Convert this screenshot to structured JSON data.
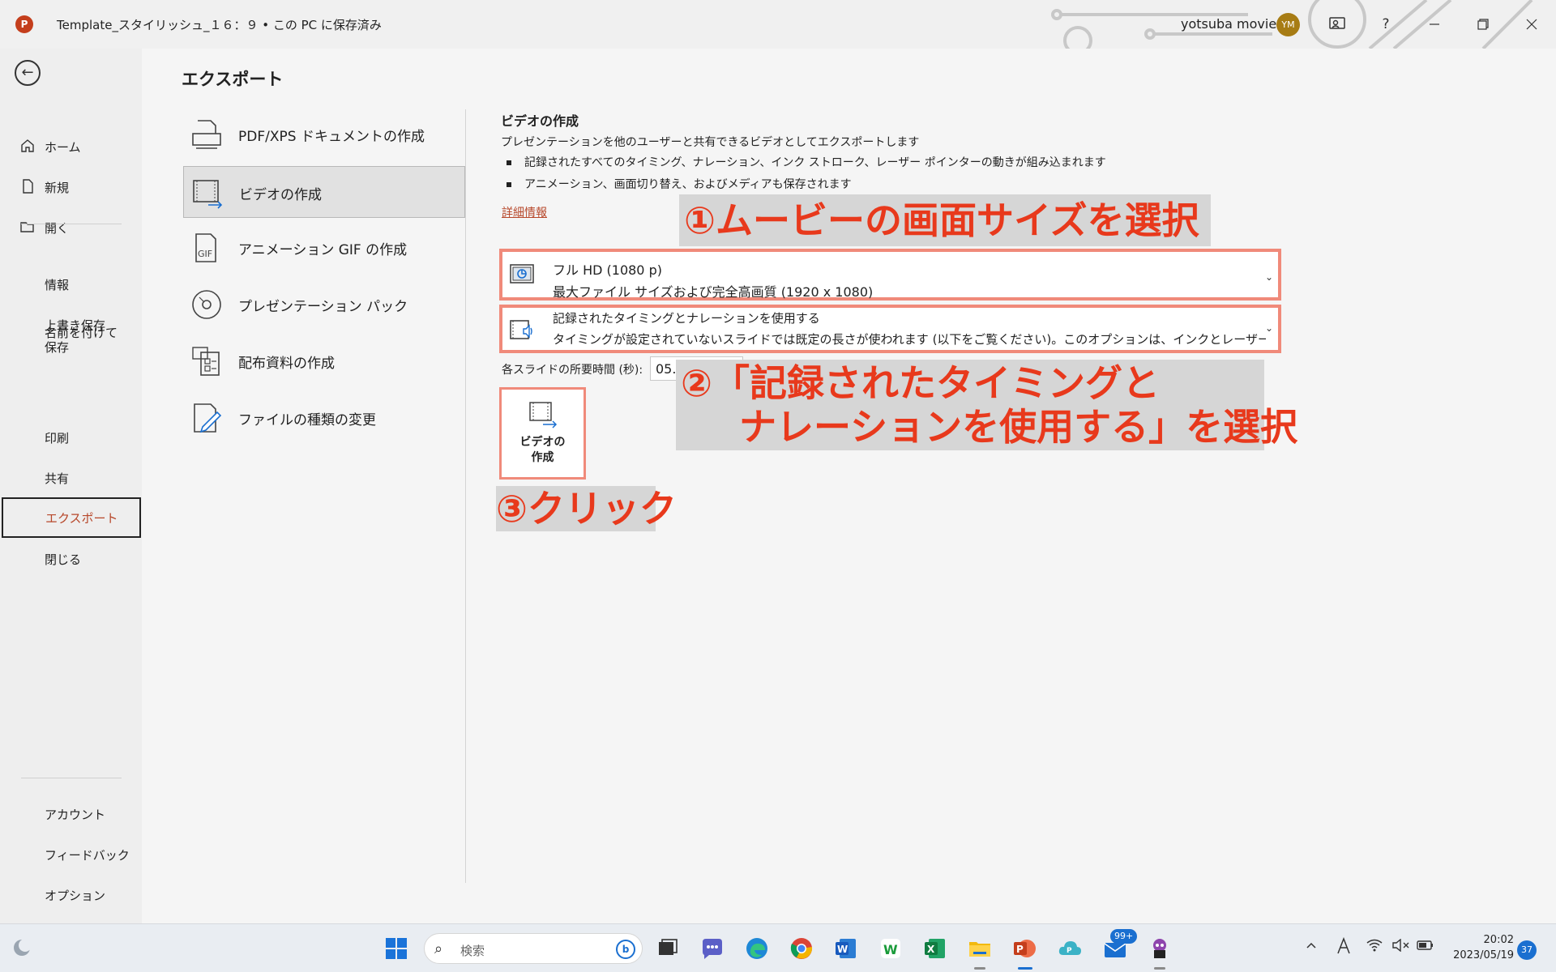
{
  "titlebar": {
    "app_icon": "P",
    "doc_title": "Template_スタイリッシュ_１６：９ • この PC に保存済み",
    "user_name": "yotsuba movie",
    "user_initials": "YM",
    "help": "?",
    "icons": [
      "coauthor-icon",
      "help-icon",
      "minimize-icon",
      "restore-icon",
      "close-icon"
    ]
  },
  "nav": {
    "items": [
      {
        "label": "ホーム",
        "icon": "home-icon"
      },
      {
        "label": "新規",
        "icon": "new-doc-icon"
      },
      {
        "label": "開く",
        "icon": "folder-open-icon"
      },
      {
        "label": "情報"
      },
      {
        "label": "上書き保存"
      },
      {
        "label": "名前を付けて保存"
      },
      {
        "label": "印刷"
      },
      {
        "label": "共有"
      },
      {
        "label": "エクスポート"
      },
      {
        "label": "閉じる"
      }
    ],
    "bottom": [
      {
        "label": "アカウント"
      },
      {
        "label": "フィードバック"
      },
      {
        "label": "オプション"
      }
    ]
  },
  "export": {
    "title": "エクスポート",
    "options": [
      {
        "label": "PDF/XPS ドキュメントの作成",
        "icon": "pdf-icon"
      },
      {
        "label": "ビデオの作成",
        "icon": "video-icon"
      },
      {
        "label": "アニメーション GIF の作成",
        "icon": "gif-icon"
      },
      {
        "label": "プレゼンテーション パック",
        "icon": "cd-icon"
      },
      {
        "label": "配布資料の作成",
        "icon": "handout-icon"
      },
      {
        "label": "ファイルの種類の変更",
        "icon": "file-type-icon"
      }
    ]
  },
  "video": {
    "title": "ビデオの作成",
    "desc": "プレゼンテーションを他のユーザーと共有できるビデオとしてエクスポートします",
    "bullets": [
      "記録されたすべてのタイミング、ナレーション、インク ストローク、レーザー ポインターの動きが組み込まれます",
      "アニメーション、画面切り替え、およびメディアも保存されます"
    ],
    "more_link": "詳細情報",
    "quality": {
      "line1": "フル HD (1080 p)",
      "line2": "最大ファイル サイズおよび完全高画質 (1920 x 1080)"
    },
    "timing": {
      "line1": "記録されたタイミングとナレーションを使用する",
      "line2": "タイミングが設定されていないスライドでは既定の長さが使われます (以下をご覧ください)。このオプションは、インクとレーザー ポインタ…"
    },
    "duration_label": "各スライドの所要時間 (秒):",
    "duration_value": "05.00",
    "create_label_1": "ビデオの",
    "create_label_2": "作成"
  },
  "annotations": {
    "a1": "①ムービーの画面サイズを選択",
    "a2_line1": "②「記録されたタイミングと",
    "a2_line2": "ナレーションを使用する」を選択",
    "a3": "③クリック"
  },
  "taskbar": {
    "search_placeholder": "検索",
    "mail_badge": "99+",
    "time": "20:02",
    "date": "2023/05/19",
    "notif_count": "37"
  },
  "colors": {
    "accent": "#b7472a",
    "annotation": "#e8391c",
    "highlight_border": "#f08a7a"
  }
}
